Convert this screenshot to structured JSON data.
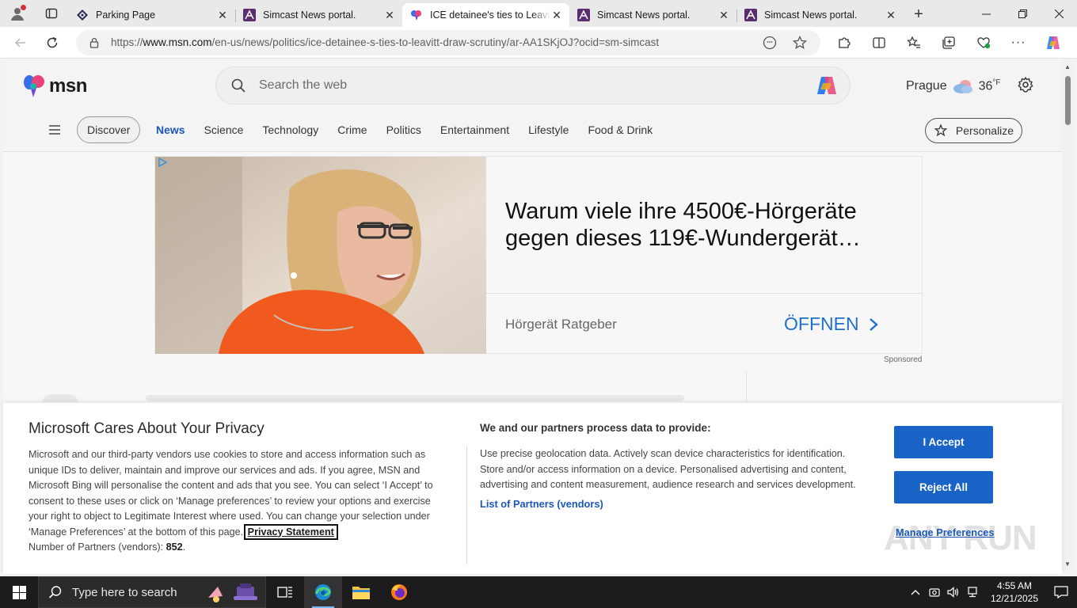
{
  "browser": {
    "tabs": [
      {
        "title": "Parking Page",
        "active": false
      },
      {
        "title": "Simcast News portal.",
        "active": false
      },
      {
        "title": "ICE detainee's ties to Leavitt draw scrutiny",
        "active": true
      },
      {
        "title": "Simcast News portal.",
        "active": false
      },
      {
        "title": "Simcast News portal.",
        "active": false
      }
    ],
    "url_prefix": "https://",
    "url_domain": "www.msn.com",
    "url_path": "/en-us/news/politics/ice-detainee-s-ties-to-leavitt-draw-scrutiny/ar-AA1SKjOJ?ocid=sm-simcast"
  },
  "msn": {
    "logo_text": "msn",
    "search_placeholder": "Search the web",
    "weather": {
      "city": "Prague",
      "temp": "36",
      "unit": "°F"
    },
    "discover_label": "Discover",
    "categories": [
      "News",
      "Science",
      "Technology",
      "Crime",
      "Politics",
      "Entertainment",
      "Lifestyle",
      "Food & Drink"
    ],
    "active_category": "News",
    "personalize_label": "Personalize"
  },
  "ad": {
    "headline": "Warum viele ihre 4500€-Hörgeräte gegen dieses 119€-Wundergerät…",
    "brand": "Hörgerät Ratgeber",
    "cta": "ÖFFNEN",
    "sponsored": "Sponsored"
  },
  "consent": {
    "title": "Microsoft Cares About Your Privacy",
    "body": "Microsoft and our third-party vendors use cookies to store and access information such as unique IDs to deliver, maintain and improve our services and ads. If you agree, MSN and Microsoft Bing will personalise the content and ads that you see. You can select ‘I Accept’ to consent to these uses or click on ‘Manage preferences’ to review your options and exercise your right to object to Legitimate Interest where used.  You can change your selection under ‘Manage Preferences’ at the bottom of this page.",
    "privacy_link": "Privacy Statement",
    "partners_label": "Number of Partners (vendors):",
    "partners_count": "852",
    "purposes_title": "We and our partners process data to provide:",
    "purposes_text": "Use precise geolocation data. Actively scan device characteristics for identification. Store and/or access information on a device. Personalised advertising and content, advertising and content measurement, audience research and services development.",
    "vendors_link": "List of Partners (vendors)",
    "accept_label": "I Accept",
    "reject_label": "Reject All",
    "manage_label": "Manage Preferences"
  },
  "watermark": "ANY RUN",
  "taskbar": {
    "search_placeholder": "Type here to search",
    "time": "4:55 AM",
    "date": "12/21/2025"
  }
}
